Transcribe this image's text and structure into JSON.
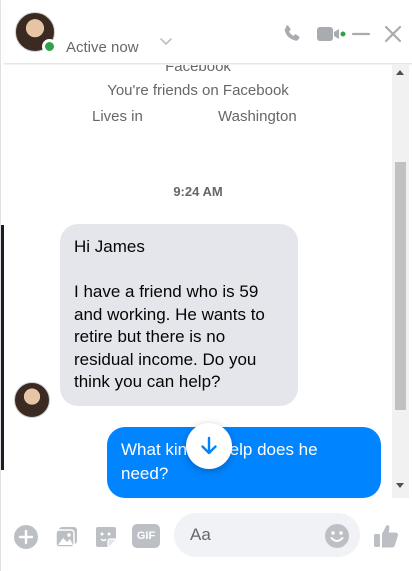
{
  "header": {
    "contact_name": "",
    "status": "Active now",
    "icons": [
      "chevron-down-icon",
      "phone-icon",
      "video-icon",
      "minimize-icon",
      "close-icon"
    ],
    "colors": {
      "icon": "#a8abaf",
      "online": "#31a24c",
      "video_dot": "#31a24c"
    }
  },
  "thread": {
    "info_partial": "Facebook",
    "friends_text": "You're friends on Facebook",
    "lives_label": "Lives in",
    "lives_city": "Washington",
    "timestamp": "9:24 AM",
    "incoming_message": "Hi James\n\nI have a friend who is 59 and working. He wants to retire but there is no residual income. Do you think you can help?",
    "outgoing_message": "What kind of help does he need?",
    "colors": {
      "incoming_bg": "#e4e6eb",
      "outgoing_bg": "#0084ff",
      "accent": "#0084ff"
    }
  },
  "composer": {
    "placeholder": "Aa",
    "icons": [
      "add-icon",
      "photo-icon",
      "sticker-icon",
      "gif-icon",
      "emoji-icon",
      "like-icon"
    ],
    "gif_label": "GIF"
  }
}
